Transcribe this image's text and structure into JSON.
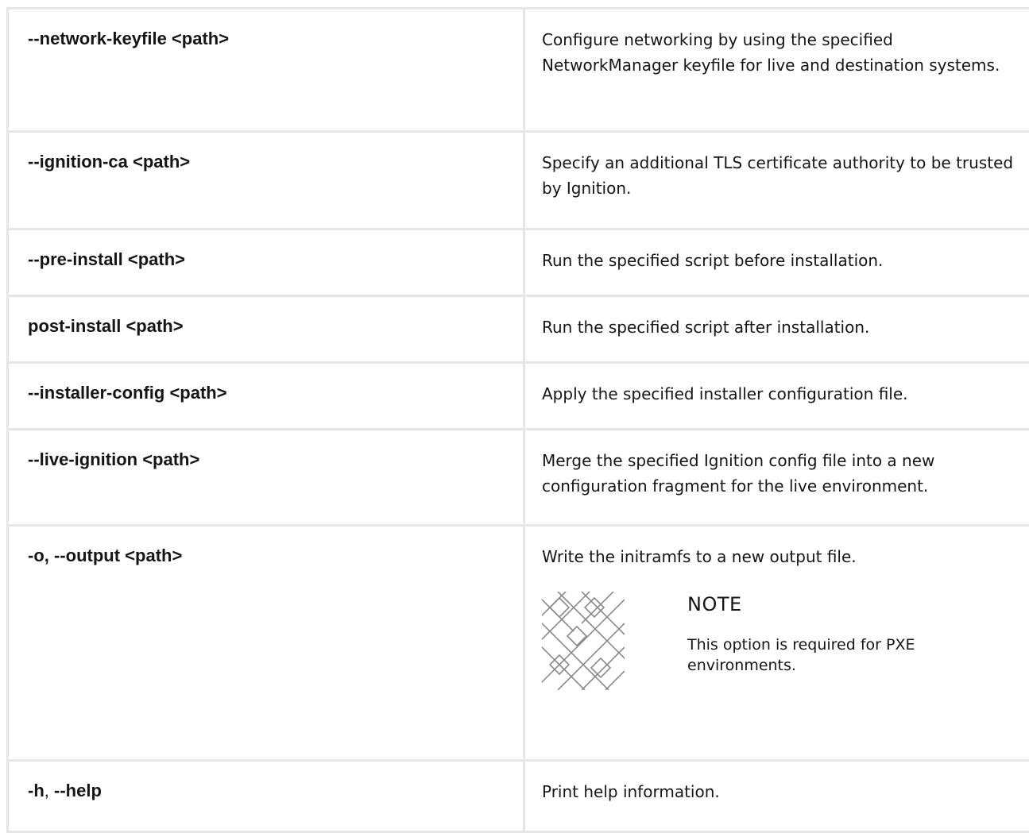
{
  "rows": [
    {
      "option": "--network-keyfile <path>",
      "description": "Configure networking by using the specified NetworkManager keyfile for live and destination systems."
    },
    {
      "option": "--ignition-ca <path>",
      "description": "Specify an additional TLS certificate authority to be trusted by Ignition."
    },
    {
      "option": "--pre-install <path>",
      "description": "Run the specified script before installation."
    },
    {
      "option": "post-install <path>",
      "description": "Run the specified script after installation."
    },
    {
      "option": "--installer-config <path>",
      "description": "Apply the specified installer configuration file."
    },
    {
      "option": "--live-ignition <path>",
      "description": "Merge the specified Ignition config file into a new configuration fragment for the live environment."
    },
    {
      "option_short": "-o,",
      "option_long": "--output <path>",
      "description": "Write the initramfs to a new output file.",
      "note": {
        "title": "NOTE",
        "text": "This option is required for PXE environments.",
        "icon": "note-pattern-icon"
      }
    },
    {
      "option_short": "-h",
      "option_sep": ",",
      "option_long": "--help",
      "description": "Print help information."
    }
  ]
}
